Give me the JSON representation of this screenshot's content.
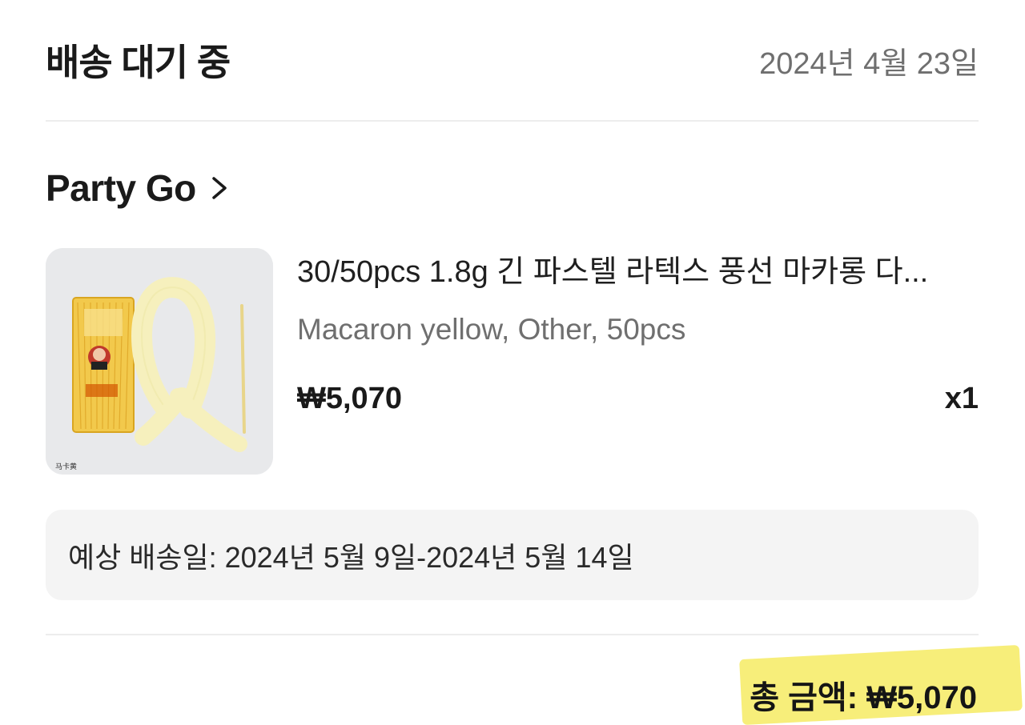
{
  "header": {
    "status_title": "배송 대기 중",
    "order_date": "2024년 4월 23일"
  },
  "store": {
    "name": "Party Go",
    "chevron_icon": "chevron-right-icon"
  },
  "product": {
    "title": "30/50pcs 1.8g 긴 파스텔 라텍스 풍선 마카롱 다...",
    "variant": "Macaron yellow, Other, 50pcs",
    "price": "₩5,070",
    "quantity": "x1",
    "thumbnail_caption": "马卡黄"
  },
  "delivery": {
    "estimate_text": "예상 배송일: 2024년 5월 9일-2024년 5월 14일"
  },
  "total": {
    "text": "총 금액: ₩5,070",
    "highlight_color": "#f6ec6c"
  }
}
